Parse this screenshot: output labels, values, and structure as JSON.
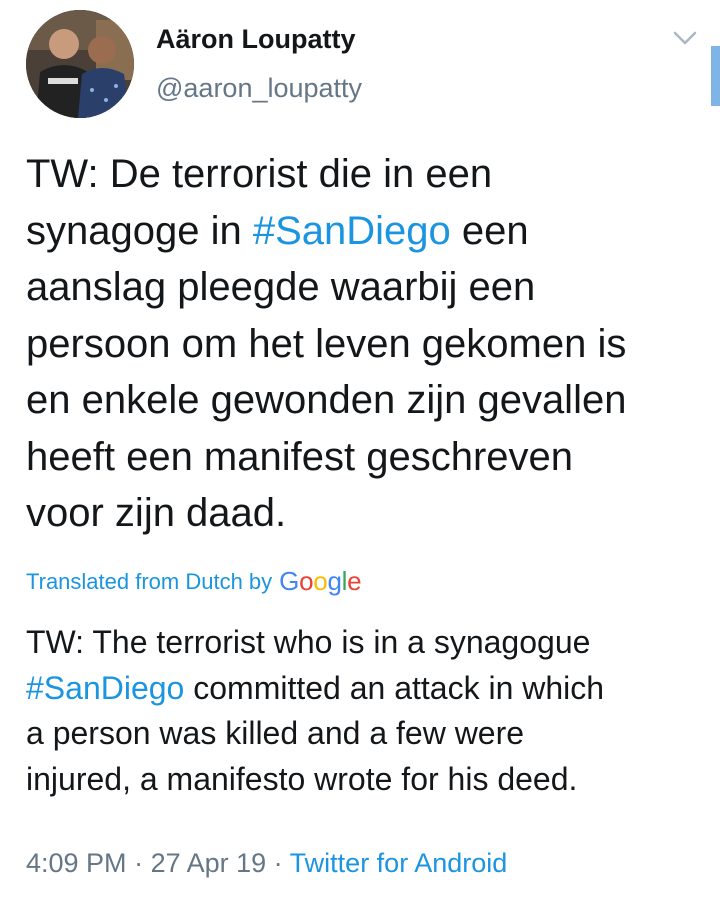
{
  "author": {
    "display_name": "Aäron Loupatty",
    "handle": "@aaron_loupatty"
  },
  "tweet": {
    "line1": "TW: De terrorist die in een",
    "line2_pre": "synagoge in ",
    "line2_hashtag": "#SanDiego",
    "line2_post": " een",
    "line3": "aanslag pleegde waarbij een",
    "line4": "persoon om het leven gekomen is",
    "line5": "en enkele gewonden zijn gevallen",
    "line6": "heeft een manifest geschreven",
    "line7": "voor zijn daad."
  },
  "translation": {
    "label": "Translated from Dutch by",
    "provider_letters": [
      "G",
      "o",
      "o",
      "g",
      "l",
      "e"
    ],
    "provider_colors": [
      "#4285f4",
      "#ea4335",
      "#fbbc05",
      "#4285f4",
      "#34a853",
      "#ea4335"
    ],
    "line1": "TW: The terrorist who is in a synagogue",
    "line2_hashtag": "#SanDiego",
    "line2_post": " committed an attack in which",
    "line3": "a person was killed and a few were",
    "line4": "injured, a manifesto wrote for his deed."
  },
  "meta": {
    "time": "4:09 PM",
    "separator": " · ",
    "date": "27 Apr 19",
    "source": "Twitter for Android"
  },
  "colors": {
    "link": "#1b95e0",
    "secondary_text": "#657786",
    "primary_text": "#14171a"
  }
}
